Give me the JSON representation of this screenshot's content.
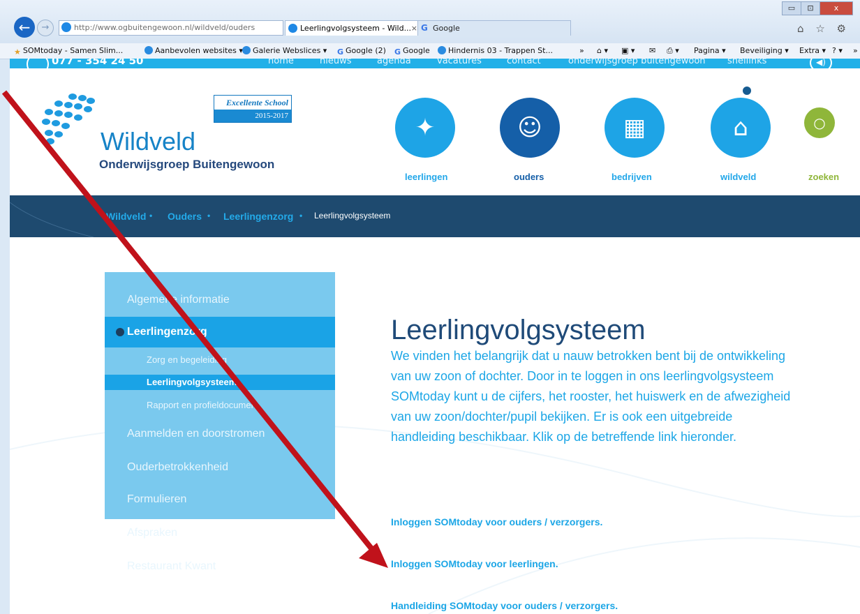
{
  "browser": {
    "address": "http://www.ogbuitengewoon.nl/wildveld/ouders",
    "address_bold": "ogbuitengewoon.nl",
    "address_tools": "⌕ ▾ ↻",
    "tabs": [
      {
        "label": "Leerlingvolgsysteem - Wild...",
        "close": "×"
      },
      {
        "label": "Google"
      }
    ],
    "window_buttons": [
      "▭",
      "⊡",
      "x"
    ],
    "right_icons": "⌂ ☆ ⚙",
    "favorites": [
      {
        "label": "SOMtoday - Samen Slim..."
      },
      {
        "label": "Aanbevolen websites ▾"
      },
      {
        "label": "Galerie Webslices ▾"
      },
      {
        "label": "Google (2)"
      },
      {
        "label": "Google"
      },
      {
        "label": "Hindernis 03 - Trappen St..."
      }
    ],
    "commands": [
      "»",
      "⌂ ▾",
      "▣ ▾",
      "✉",
      "⎙ ▾",
      "Pagina ▾",
      "Beveiliging ▾",
      "Extra ▾",
      "? ▾",
      "»"
    ]
  },
  "topbar": {
    "phone": "077 - 354 24 50",
    "links": [
      "home",
      "nieuws",
      "agenda",
      "vacatures",
      "contact",
      "onderwijsgroep buitengewoon",
      "snellinks"
    ]
  },
  "header": {
    "logo_name": "Wildveld",
    "logo_sub": "Onderwijsgroep Buitengewoon",
    "badge_title": "Excellente School",
    "badge_years": "2015-2017",
    "nav": [
      {
        "label": "leerlingen",
        "icon": "students-icon"
      },
      {
        "label": "ouders",
        "icon": "parents-icon"
      },
      {
        "label": "bedrijven",
        "icon": "building-icon"
      },
      {
        "label": "wildveld",
        "icon": "school-icon"
      },
      {
        "label": "zoeken",
        "icon": "search-icon"
      }
    ]
  },
  "breadcrumb": {
    "items": [
      "Wildveld",
      "Ouders",
      "Leerlingenzorg",
      "Leerlingvolgsysteem"
    ],
    "separator": "•"
  },
  "sidebar": {
    "items": [
      {
        "label": "Algemene informatie"
      },
      {
        "label": "Leerlingenzorg"
      },
      {
        "label": "Zorg en begeleiding"
      },
      {
        "label": "Leerlingvolgsysteem"
      },
      {
        "label": "Rapport en profieldocument"
      },
      {
        "label": "Aanmelden en doorstromen"
      },
      {
        "label": "Ouderbetrokkenheid"
      },
      {
        "label": "Formulieren"
      },
      {
        "label": "Afspraken"
      },
      {
        "label": "Restaurant Kwant"
      }
    ]
  },
  "content": {
    "title": "Leerlingvolgsysteem",
    "body": "We vinden het belangrijk dat u nauw betrokken bent bij de ontwikkeling van uw zoon of dochter. Door in te loggen in ons leerlingvolgsysteem SOMtoday kunt u de cijfers, het rooster, het huiswerk en de afwezigheid van uw zoon/dochter/pupil bekijken. Er is ook een uitgebreide handleiding beschikbaar. Klik op de betreffende link hieronder.",
    "links": [
      "Inloggen SOMtoday voor ouders / verzorgers.",
      "Inloggen SOMtoday voor leerlingen.",
      "Handleiding SOMtoday voor ouders / verzorgers."
    ]
  },
  "annotation": {
    "arrow_color": "#c0121b"
  }
}
